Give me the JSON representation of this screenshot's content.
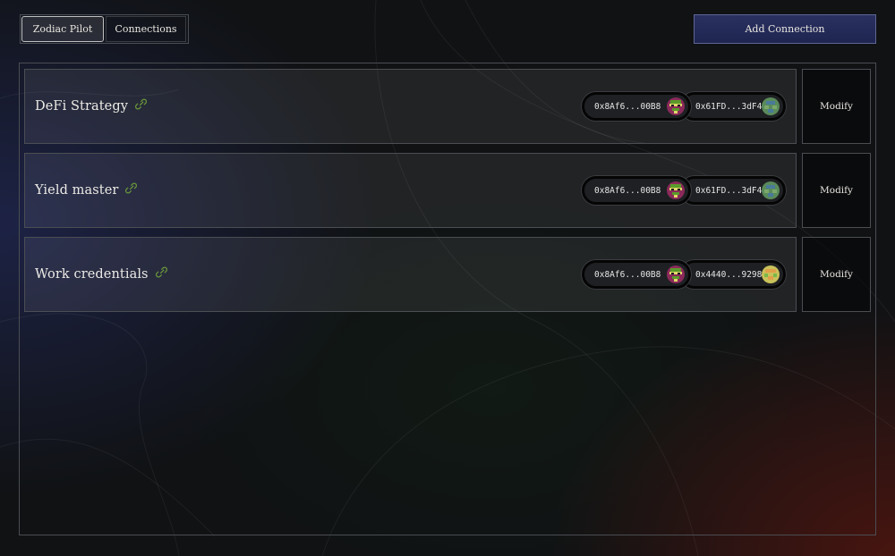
{
  "app": {
    "tabs": [
      {
        "label": "Zodiac Pilot",
        "active": true
      },
      {
        "label": "Connections",
        "active": false
      }
    ],
    "add_connection_label": "Add Connection"
  },
  "connections": [
    {
      "name": "DeFi Strategy",
      "link_icon": "link-icon",
      "pilot_address": "0x8Af6...00B8",
      "avatar_address": "0x61FD...3dF4",
      "modify_label": "Modify"
    },
    {
      "name": "Yield master",
      "link_icon": "link-icon",
      "pilot_address": "0x8Af6...00B8",
      "avatar_address": "0x61FD...3dF4",
      "modify_label": "Modify"
    },
    {
      "name": "Work credentials",
      "link_icon": "link-icon",
      "pilot_address": "0x8Af6...00B8",
      "avatar_address": "0x4440...9298",
      "modify_label": "Modify"
    }
  ],
  "colors": {
    "link_icon": "#6b9a3a",
    "accent_button": "#262d5a",
    "pilot_blockie": "#8a2a5a",
    "avatar_blockie_green": "#5a8a5a",
    "avatar_blockie_yellow": "#c9c25a"
  }
}
